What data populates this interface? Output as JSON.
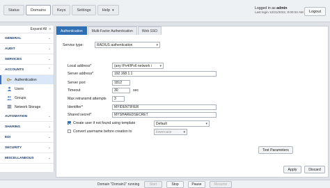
{
  "topnav": {
    "tabs": [
      "Status",
      "Domains",
      "Keys",
      "Settings",
      "Help"
    ],
    "active_tab": "Domains"
  },
  "login": {
    "prefix": "Logged in as",
    "user": "admin",
    "last_login": "Last login 12/21/2022, 8:00:04 AM",
    "logout_label": "Logout"
  },
  "sidebar": {
    "expand_label": "Expand All",
    "sections": {
      "general": "GENERAL",
      "audit": "AUDIT",
      "services": "SERVICES",
      "accounts": "ACCOUNTS",
      "automation": "AUTOMATION",
      "sharing": "SHARING",
      "edi": "EDI",
      "security": "SECURITY",
      "misc": "MISCELLANEOUS"
    },
    "accounts_items": {
      "authentication": "Authentication",
      "users": "Users",
      "groups": "Groups",
      "network_storage": "Network Storage"
    }
  },
  "content_tabs": [
    "Authentication",
    "Multi-Factor Authentication",
    "Web SSO"
  ],
  "form": {
    "service_type_label": "Service type:",
    "service_type_value": "RADIUS authentication",
    "local_address_label": "Local address*",
    "local_address_value": "(any IPv4/IPv6 network i",
    "server_address_label": "Server address*",
    "server_address_value": "192.168.1.1",
    "server_port_label": "Server port",
    "server_port_value": "1812",
    "timeout_label": "Timeout",
    "timeout_value": "30",
    "timeout_unit": "sec",
    "max_retrans_label": "Max retransmit attempts",
    "max_retrans_value": "3",
    "identifier_label": "Identifier*",
    "identifier_value": "MYIDENTIFIER",
    "shared_secret_label": "Shared secret*",
    "shared_secret_value": "MYSHAREDSECRET",
    "create_user_label": "Create user if not found using template",
    "create_user_checked": true,
    "template_value": "Default",
    "convert_label": "Convert username before creation to",
    "convert_checked": false,
    "convert_value": "lowercase",
    "test_button": "Test Parameters",
    "apply_button": "Apply",
    "discard_button": "Discard"
  },
  "footer": {
    "status": "Domain \"Domain1\" running",
    "start": "Start",
    "stop": "Stop",
    "pause": "Pause",
    "resume": "Resume"
  },
  "colors": {
    "accent": "#2f6fb3",
    "section_text": "#1b3d6d"
  }
}
